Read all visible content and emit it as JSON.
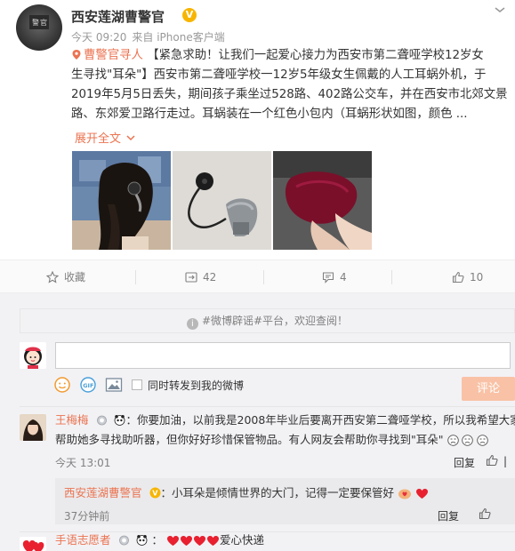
{
  "post": {
    "author": "西安莲湖曹警官",
    "verified_badge": "V",
    "time": "今天 09:20",
    "source": "来自 iPhone客户端",
    "mention": "曹警官寻人",
    "lines": [
      "【紧急求助！让我们一起爱心接力为西安市第二聋哑学校12岁女",
      "生寻找\"耳朵\"】西安市第二聋哑学校一12岁5年级女生佩戴的人工耳蜗外机，于",
      "2019年5月5日丢失，期间孩子乘坐过528路、402路公交车，并在西安市北郊文景",
      "路、东郊爱卫路行走过。耳蜗装在一个红色小包内（耳蜗形状如图，颜色 ..."
    ],
    "expand": "展开全文",
    "expand_icon": "chevron-down-icon",
    "images": [
      "girl-wearing-cochlear-implant",
      "cochlear-implant-device",
      "red-pouch"
    ]
  },
  "actions": {
    "favorite": "收藏",
    "share": "42",
    "comment": "4",
    "like": "10"
  },
  "comments": {
    "notice": "#微博辟谣#平台，欢迎查阅！",
    "submit": "评论",
    "repost_label": "同时转发到我的微博",
    "items": [
      {
        "name": "王梅梅",
        "lines": [
          "：你要加油，以前我是2008年毕业后要离开西安第二聋哑学校，所以我希望大家",
          "帮助她多寻找助听器，但你好好珍惜保管物品。有人网友会帮助你寻找到\"耳朵\""
        ],
        "time": "今天 13:01",
        "reply": "回复"
      },
      {
        "name": "西安莲湖曹警官",
        "text": "：小耳朵是倾情世界的大门，记得一定要保管好",
        "time": "37分钟前",
        "reply": "回复"
      },
      {
        "name": "手语志愿者",
        "text": "爱心快递"
      }
    ]
  },
  "colors": {
    "accent": "#eb7350",
    "verified": "#f7b500",
    "submit_bg": "#f9c2a6"
  }
}
